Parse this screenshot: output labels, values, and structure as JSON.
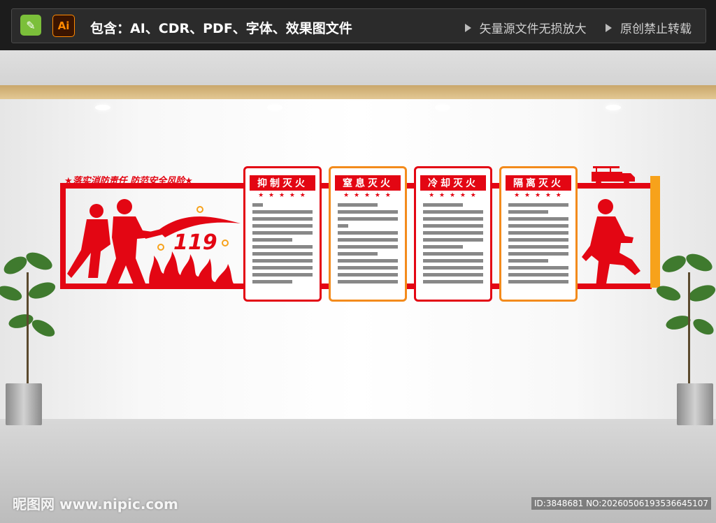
{
  "top": {
    "app_badge_1": "✎",
    "app_badge_2": "Ai",
    "title": "包含：AI、CDR、PDF、字体、效果图文件",
    "notes": [
      "矢量源文件无损放大",
      "原创禁止转载"
    ]
  },
  "banner": {
    "slogan": "★落实消防责任  防范安全风险★",
    "number": "119"
  },
  "cards": [
    {
      "title": "抑制灭火",
      "stars": "★ ★ ★ ★ ★"
    },
    {
      "title": "窒息灭火",
      "stars": "★ ★ ★ ★ ★"
    },
    {
      "title": "冷却灭火",
      "stars": "★ ★ ★ ★ ★"
    },
    {
      "title": "隔离灭火",
      "stars": "★ ★ ★ ★ ★"
    }
  ],
  "watermark": {
    "site": "昵图网 www.nipic.com",
    "id": "ID:3848681 NO:20260506193536645107"
  },
  "colors": {
    "accent": "#e30613",
    "orange": "#f7a21b",
    "dark": "#1c1c1c"
  }
}
